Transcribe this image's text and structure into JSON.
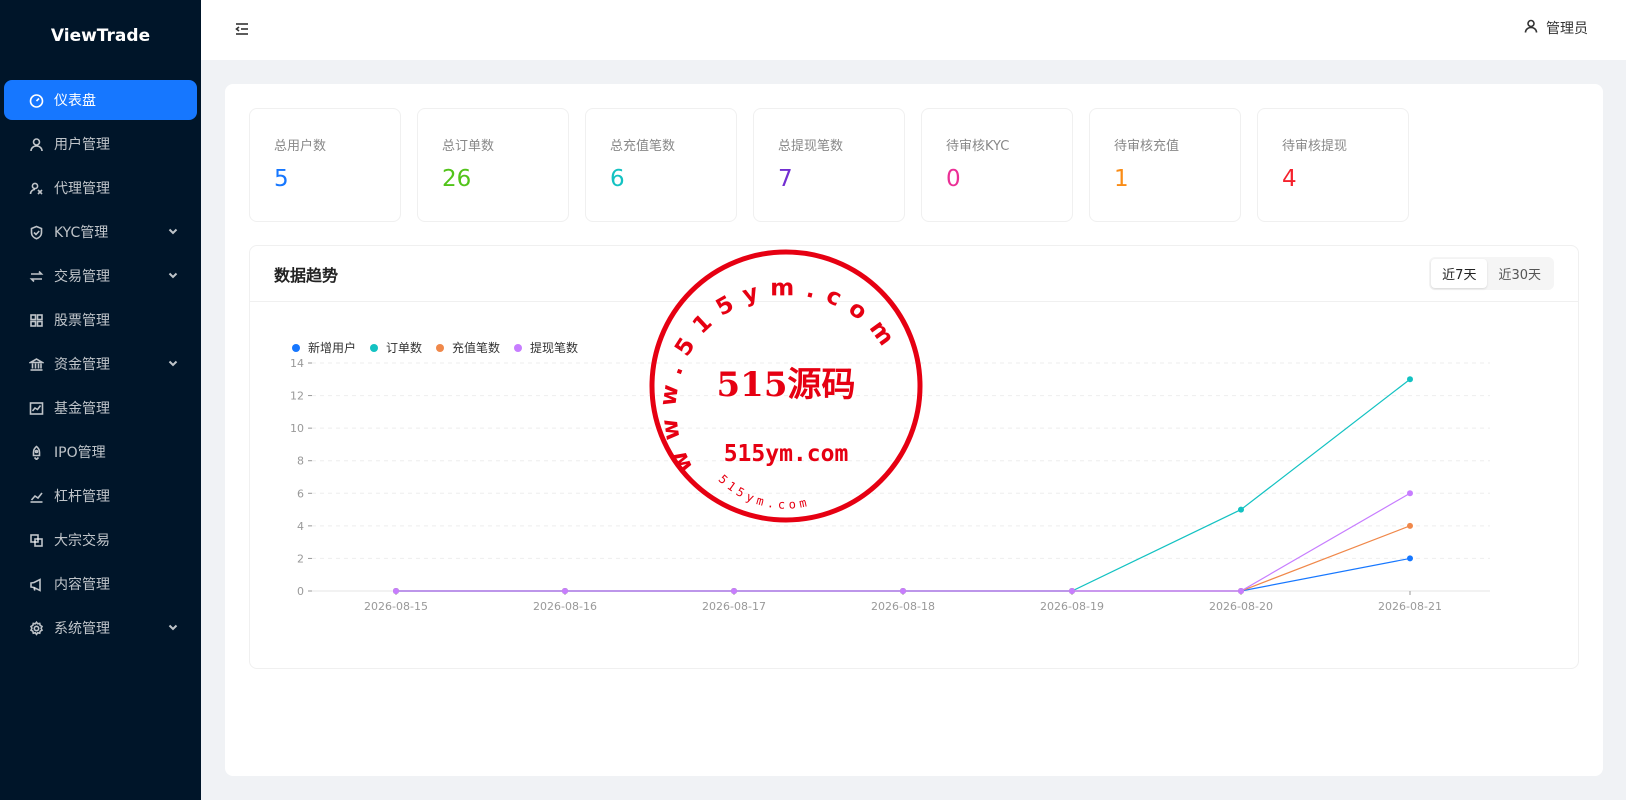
{
  "app": {
    "name": "ViewTrade"
  },
  "sidebar": {
    "items": [
      {
        "label": "仪表盘",
        "icon": "dashboard-icon",
        "active": true,
        "has_children": false
      },
      {
        "label": "用户管理",
        "icon": "user-icon",
        "active": false,
        "has_children": false
      },
      {
        "label": "代理管理",
        "icon": "agent-icon",
        "active": false,
        "has_children": false
      },
      {
        "label": "KYC管理",
        "icon": "shield-icon",
        "active": false,
        "has_children": true
      },
      {
        "label": "交易管理",
        "icon": "swap-icon",
        "active": false,
        "has_children": true
      },
      {
        "label": "股票管理",
        "icon": "grid-icon",
        "active": false,
        "has_children": false
      },
      {
        "label": "资金管理",
        "icon": "bank-icon",
        "active": false,
        "has_children": true
      },
      {
        "label": "基金管理",
        "icon": "stock-chart-icon",
        "active": false,
        "has_children": false
      },
      {
        "label": "IPO管理",
        "icon": "rocket-icon",
        "active": false,
        "has_children": false
      },
      {
        "label": "杠杆管理",
        "icon": "line-chart-icon",
        "active": false,
        "has_children": false
      },
      {
        "label": "大宗交易",
        "icon": "block-icon",
        "active": false,
        "has_children": false
      },
      {
        "label": "内容管理",
        "icon": "notification-icon",
        "active": false,
        "has_children": false
      },
      {
        "label": "系统管理",
        "icon": "settings-icon",
        "active": false,
        "has_children": true
      }
    ]
  },
  "header": {
    "user_label": "管理员"
  },
  "stats": [
    {
      "title": "总用户数",
      "value": "5",
      "color": "#1677ff"
    },
    {
      "title": "总订单数",
      "value": "26",
      "color": "#52c41a"
    },
    {
      "title": "总充值笔数",
      "value": "6",
      "color": "#13c2c2"
    },
    {
      "title": "总提现笔数",
      "value": "7",
      "color": "#722ed1"
    },
    {
      "title": "待审核KYC",
      "value": "0",
      "color": "#eb2f96"
    },
    {
      "title": "待审核充值",
      "value": "1",
      "color": "#fa8c16"
    },
    {
      "title": "待审核提现",
      "value": "4",
      "color": "#f5222d"
    }
  ],
  "trend": {
    "title": "数据趋势",
    "range_options": [
      "近7天",
      "近30天"
    ],
    "selected_range": "近7天"
  },
  "chart_data": {
    "type": "line",
    "x": [
      "2026-08-15",
      "2026-08-16",
      "2026-08-17",
      "2026-08-18",
      "2026-08-19",
      "2026-08-20",
      "2026-08-21"
    ],
    "series": [
      {
        "name": "新增用户",
        "color": "#1677ff",
        "values": [
          0,
          0,
          0,
          0,
          0,
          0,
          2
        ]
      },
      {
        "name": "订单数",
        "color": "#13c2c2",
        "values": [
          0,
          0,
          0,
          0,
          0,
          5,
          13
        ]
      },
      {
        "name": "充值笔数",
        "color": "#f0884a",
        "values": [
          0,
          0,
          0,
          0,
          0,
          0,
          4
        ]
      },
      {
        "name": "提现笔数",
        "color": "#c77dff",
        "values": [
          0,
          0,
          0,
          0,
          0,
          0,
          6
        ]
      }
    ],
    "ylim": [
      0,
      14
    ],
    "yticks": [
      0,
      2,
      4,
      6,
      8,
      10,
      12,
      14
    ],
    "grid": true,
    "legend": "top-left"
  },
  "watermark": {
    "ring_text": "www.515ym.com",
    "center_text": "515源码",
    "domain_text": "515ym.com",
    "bottom_text": "515ym.com",
    "color": "#e60012"
  }
}
